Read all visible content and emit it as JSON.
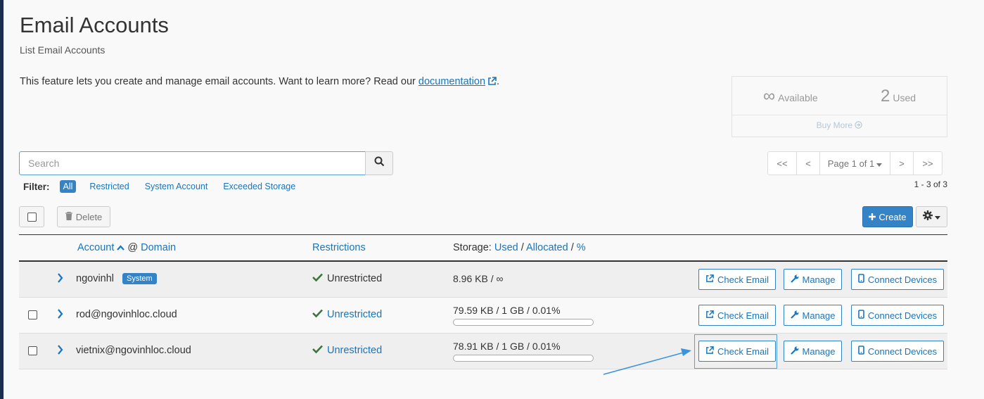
{
  "header": {
    "title": "Email Accounts",
    "subtitle": "List Email Accounts",
    "intro_text": "This feature lets you create and manage email accounts. Want to learn more? Read our",
    "doc_link": "documentation",
    "intro_end": "."
  },
  "stats": {
    "available_value": "∞",
    "available_label": "Available",
    "used_value": "2",
    "used_label": "Used",
    "buy_more": "Buy More"
  },
  "search": {
    "placeholder": "Search"
  },
  "filter": {
    "label": "Filter:",
    "options": [
      "All",
      "Restricted",
      "System Account",
      "Exceeded Storage"
    ],
    "active": "All"
  },
  "pager": {
    "first": "<<",
    "prev": "<",
    "page": "Page 1 of 1",
    "next": ">",
    "last": ">>",
    "range": "1 - 3 of 3"
  },
  "toolbar": {
    "delete": "Delete",
    "create": "Create"
  },
  "table": {
    "col_account": "Account",
    "col_at": "@",
    "col_domain": "Domain",
    "col_restrictions": "Restrictions",
    "col_storage_prefix": "Storage:",
    "col_storage_used": "Used",
    "col_storage_allocated": "Allocated",
    "col_storage_percent": "%",
    "sep": "/",
    "rows": [
      {
        "account": "ngovinhl",
        "badge": "System",
        "restriction": "Unrestricted",
        "storage": "8.96 KB / ∞",
        "usage_fraction": 0,
        "check_email": "Check Email",
        "manage": "Manage",
        "connect": "Connect Devices"
      },
      {
        "account": "rod@ngovinhloc.cloud",
        "restriction": "Unrestricted",
        "storage": "79.59 KB / 1 GB / 0.01%",
        "usage_fraction": 0.0001,
        "check_email": "Check Email",
        "manage": "Manage",
        "connect": "Connect Devices"
      },
      {
        "account": "vietnix@ngovinhloc.cloud",
        "restriction": "Unrestricted",
        "storage": "78.91 KB / 1 GB / 0.01%",
        "usage_fraction": 0.0001,
        "check_email": "Check Email",
        "manage": "Manage",
        "connect": "Connect Devices"
      }
    ]
  },
  "colors": {
    "accent": "#3583c7",
    "link": "#1a75bb",
    "check": "#3c763d",
    "annotation": "#3a93dc"
  }
}
